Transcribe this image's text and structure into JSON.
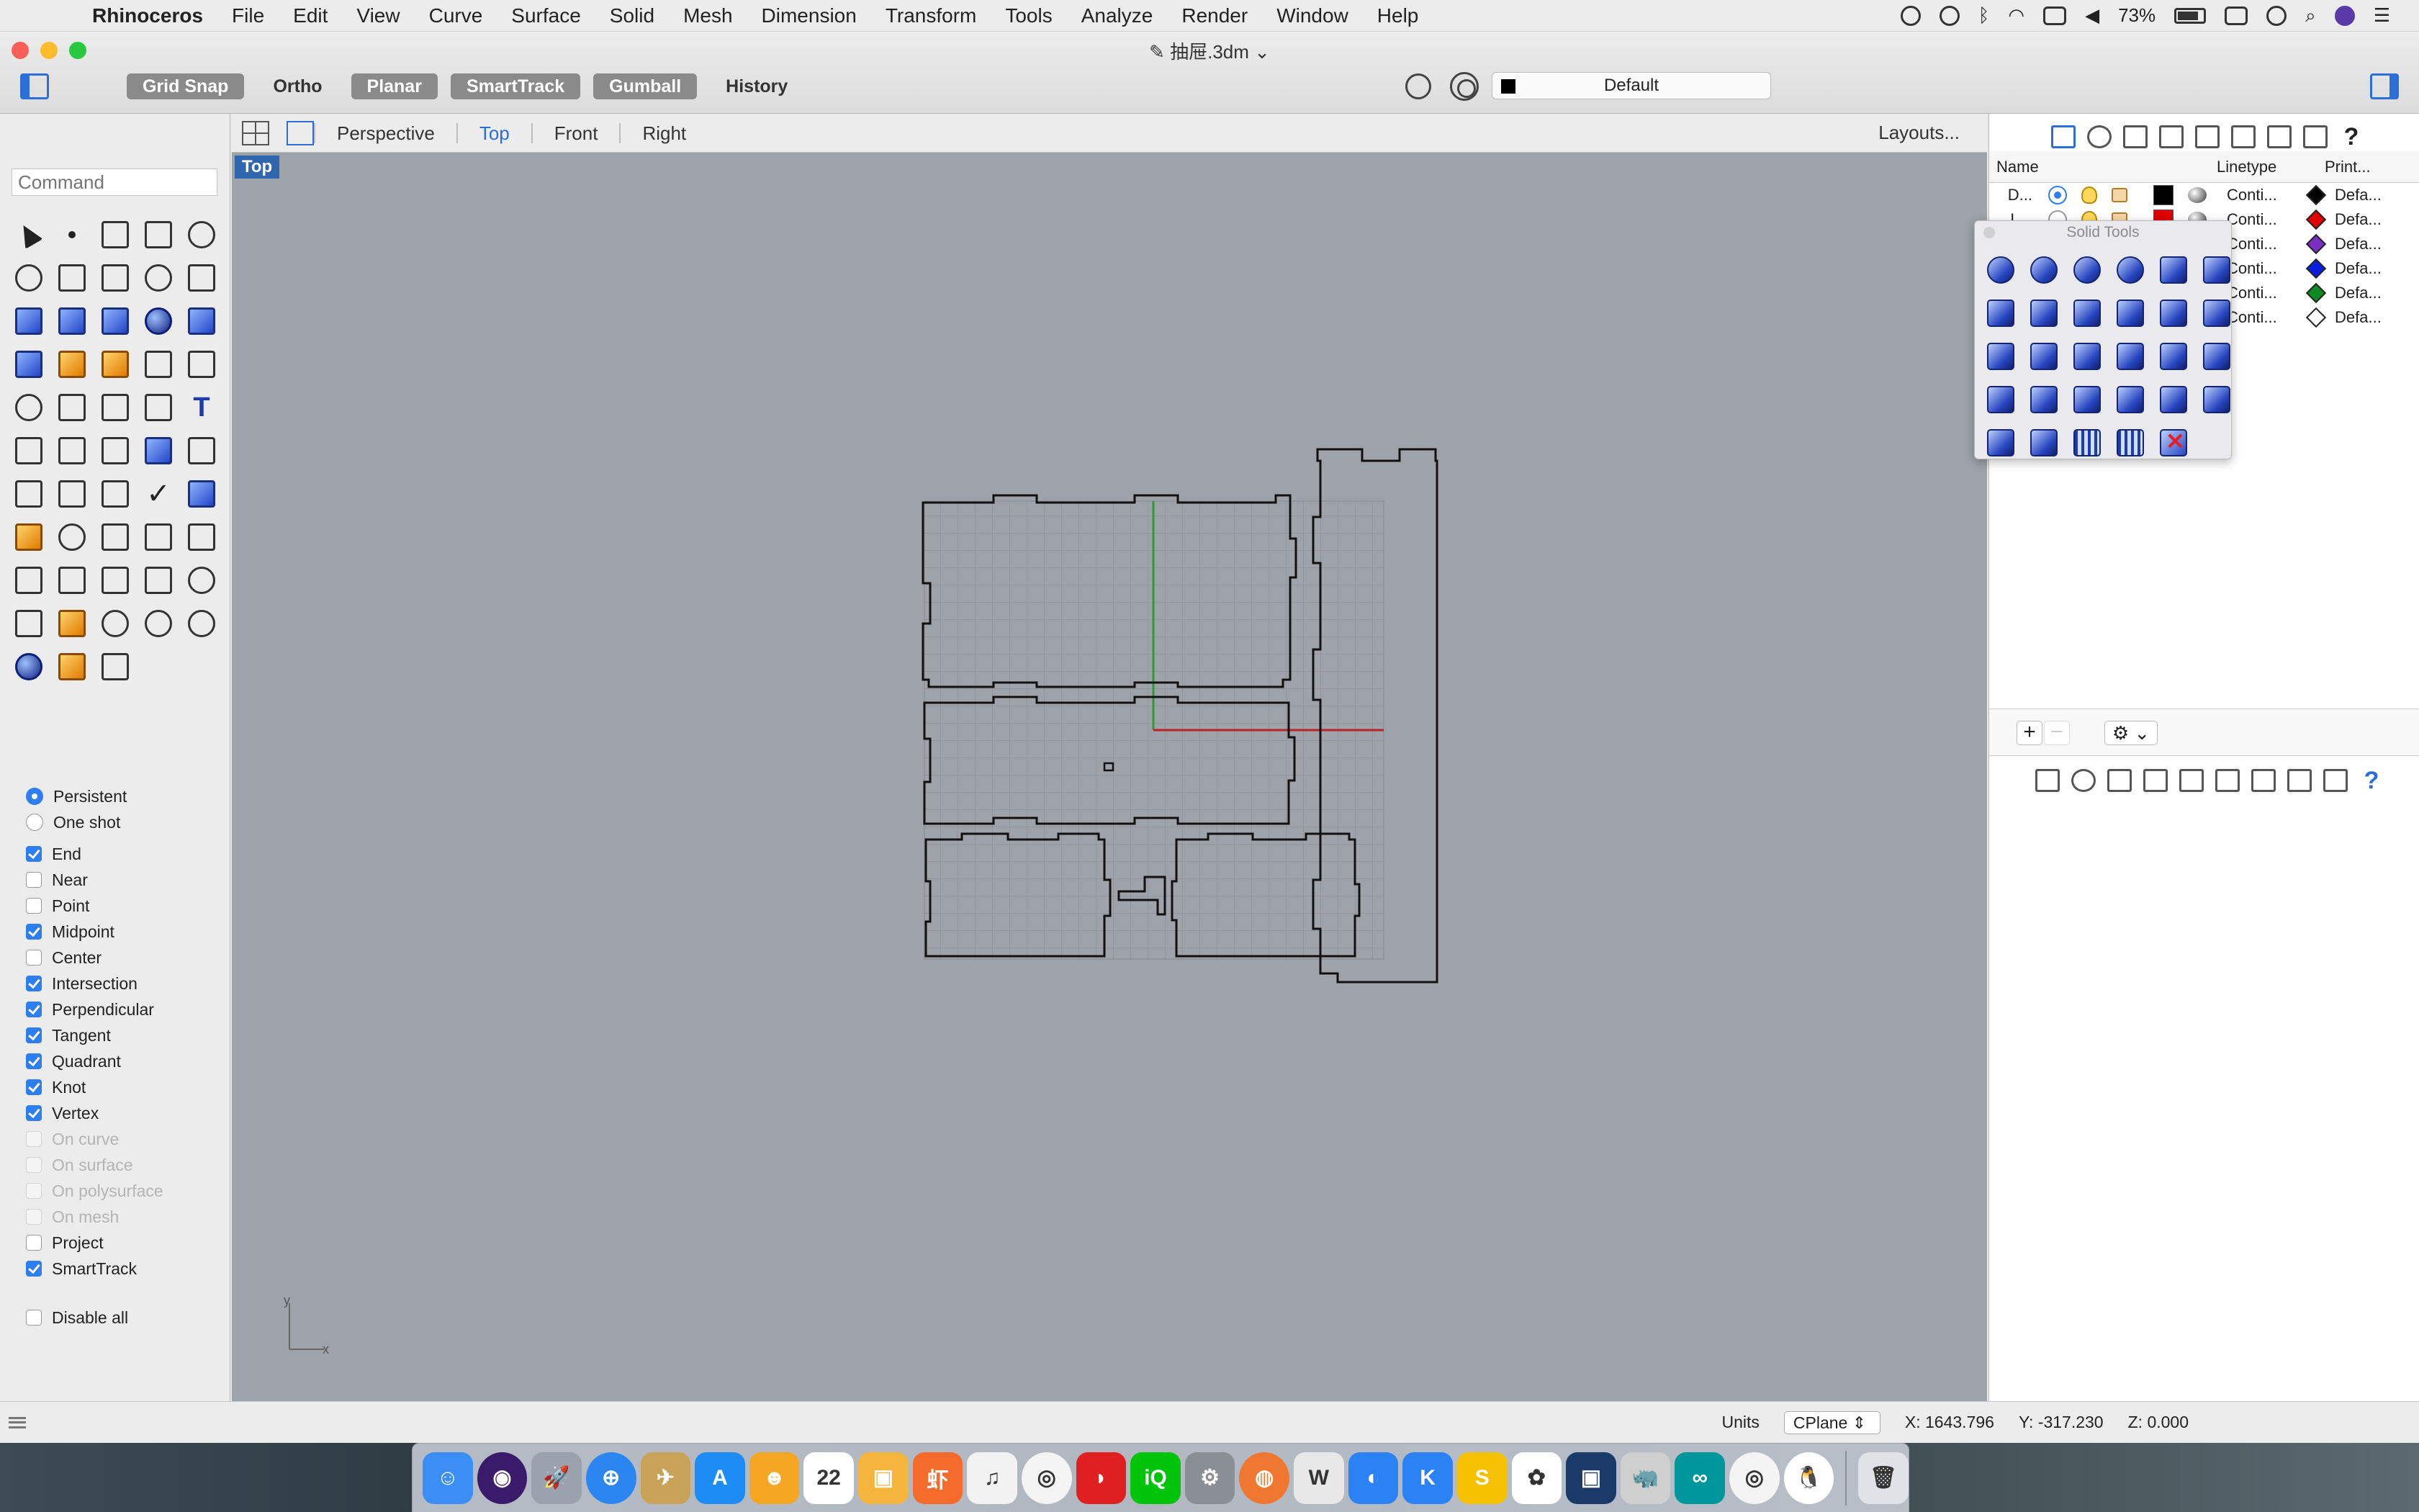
{
  "menubar": {
    "app_name": "Rhinoceros",
    "items": [
      "File",
      "Edit",
      "View",
      "Curve",
      "Surface",
      "Solid",
      "Mesh",
      "Dimension",
      "Transform",
      "Tools",
      "Analyze",
      "Render",
      "Window",
      "Help"
    ],
    "battery": "73%"
  },
  "window": {
    "title": "抽屉.3dm",
    "toggles": [
      "Grid Snap",
      "Ortho",
      "Planar",
      "SmartTrack",
      "Gumball",
      "History"
    ],
    "toggles_on": [
      true,
      false,
      true,
      true,
      true,
      false
    ],
    "current_layer": "Default"
  },
  "command": {
    "placeholder": "Command"
  },
  "tools": [
    "select-arrow",
    "point",
    "polyline",
    "curve",
    "circle",
    "ellipse",
    "polygon",
    "rectangle",
    "polygon-2",
    "fillet",
    "surface-patch",
    "extrude-surface",
    "box",
    "boolean-union",
    "cylinder",
    "plane-surface",
    "gear",
    "explode",
    "trim",
    "split",
    "boolean-difference",
    "group",
    "curve-edit",
    "offset",
    "text",
    "move",
    "array",
    "mirror",
    "box-edge",
    "dimension",
    "grid-array",
    "align",
    "blend",
    "check",
    "shade",
    "paint",
    "zoom",
    "zoom-window",
    "zoom-extents",
    "zoom-selected",
    "rotate-view",
    "car",
    "grid-surface",
    "lights",
    "bulb",
    "lock",
    "layer",
    "color-wheel",
    "sphere-wire",
    "sphere-grid",
    "render-sphere",
    "cone",
    "measure"
  ],
  "osnaps": {
    "mode": [
      {
        "label": "Persistent",
        "on": true
      },
      {
        "label": "One shot",
        "on": false
      }
    ],
    "items": [
      {
        "label": "End",
        "checked": true,
        "enabled": true
      },
      {
        "label": "Near",
        "checked": false,
        "enabled": true
      },
      {
        "label": "Point",
        "checked": false,
        "enabled": true
      },
      {
        "label": "Midpoint",
        "checked": true,
        "enabled": true
      },
      {
        "label": "Center",
        "checked": false,
        "enabled": true
      },
      {
        "label": "Intersection",
        "checked": true,
        "enabled": true
      },
      {
        "label": "Perpendicular",
        "checked": true,
        "enabled": true
      },
      {
        "label": "Tangent",
        "checked": true,
        "enabled": true
      },
      {
        "label": "Quadrant",
        "checked": true,
        "enabled": true
      },
      {
        "label": "Knot",
        "checked": true,
        "enabled": true
      },
      {
        "label": "Vertex",
        "checked": true,
        "enabled": true
      },
      {
        "label": "On curve",
        "checked": false,
        "enabled": false
      },
      {
        "label": "On surface",
        "checked": false,
        "enabled": false
      },
      {
        "label": "On polysurface",
        "checked": false,
        "enabled": false
      },
      {
        "label": "On mesh",
        "checked": false,
        "enabled": false
      },
      {
        "label": "Project",
        "checked": false,
        "enabled": true
      },
      {
        "label": "SmartTrack",
        "checked": true,
        "enabled": true
      }
    ],
    "disable_all": "Disable all"
  },
  "viewtabs": {
    "tabs": [
      "Perspective",
      "Top",
      "Front",
      "Right"
    ],
    "active": "Top",
    "layouts": "Layouts..."
  },
  "viewport": {
    "label": "Top",
    "axis_y": "y",
    "axis_x": "x"
  },
  "statusbar": {
    "units": "Units",
    "cplane": "CPlane",
    "x": "X: 1643.796",
    "y": "Y: -317.230",
    "z": "Z: 0.000"
  },
  "layers": {
    "headers": {
      "name": "Name",
      "linetype": "Linetype",
      "print": "Print..."
    },
    "rows": [
      {
        "name": "D...",
        "current": true,
        "color": "#000000",
        "linetype": "Conti...",
        "print_color": "#000000",
        "print": "Defa..."
      },
      {
        "name": "L...",
        "current": false,
        "color": "#e00000",
        "linetype": "Conti...",
        "print_color": "#e00000",
        "print": "Defa..."
      },
      {
        "name": "",
        "current": false,
        "color": "#7a2ec2",
        "linetype": "Conti...",
        "print_color": "#7a2ec2",
        "print": "Defa..."
      },
      {
        "name": "",
        "current": false,
        "color": "#0a1ee0",
        "linetype": "Conti...",
        "print_color": "#0a1ee0",
        "print": "Defa..."
      },
      {
        "name": "",
        "current": false,
        "color": "#0f8a20",
        "linetype": "Conti...",
        "print_color": "#0f8a20",
        "print": "Defa..."
      },
      {
        "name": "",
        "current": false,
        "color": "#ffffff",
        "linetype": "Conti...",
        "print_color": "#ffffff",
        "print": "Defa..."
      }
    ],
    "add": "+",
    "remove": "−",
    "gear": "⚙ ⌄"
  },
  "solid_tools": {
    "title": "Solid Tools",
    "buttons": [
      "boolean-union",
      "boolean-difference",
      "boolean-intersection",
      "boolean-split",
      "cap-planar-holes",
      "extract-surface",
      "extrude-face",
      "slab",
      "box-edge",
      "merge-faces",
      "fillet-edge",
      "chamfer-edge",
      "offset-face",
      "move-face",
      "move-edge",
      "split-face",
      "move-face-to",
      "extrude-curve",
      "wire-cut",
      "rib",
      "shell",
      "tapered-extrude",
      "unroll",
      "solid-point",
      "solid-edit-1",
      "solid-edit-2",
      "grid-points-1",
      "grid-points-2",
      "delete-hole"
    ]
  },
  "dock": {
    "apps": [
      {
        "name": "finder",
        "bg": "#3a8ef5",
        "glyph": "☺"
      },
      {
        "name": "siri",
        "bg": "#3a1a6a",
        "glyph": "◉"
      },
      {
        "name": "launchpad",
        "bg": "#9aa2ad",
        "glyph": "🚀"
      },
      {
        "name": "safari",
        "bg": "#2b86f2",
        "glyph": "⊕"
      },
      {
        "name": "preview",
        "bg": "#c9a25a",
        "glyph": "✈"
      },
      {
        "name": "app-store",
        "bg": "#1d8cf5",
        "glyph": "A"
      },
      {
        "name": "pages",
        "bg": "#f5a623",
        "glyph": "☻"
      },
      {
        "name": "calendar",
        "bg": "#ffffff",
        "glyph": "22"
      },
      {
        "name": "package",
        "bg": "#f5b43c",
        "glyph": "▣"
      },
      {
        "name": "xiami",
        "bg": "#f56b2b",
        "glyph": "虾"
      },
      {
        "name": "itunes",
        "bg": "#f2f2f2",
        "glyph": "♫"
      },
      {
        "name": "chrome",
        "bg": "#f4f4f4",
        "glyph": "◎"
      },
      {
        "name": "netease-music",
        "bg": "#e02020",
        "glyph": "◗"
      },
      {
        "name": "iqiyi",
        "bg": "#00c40a",
        "glyph": "iQ"
      },
      {
        "name": "system-preferences",
        "bg": "#8a8f96",
        "glyph": "⚙"
      },
      {
        "name": "firefox",
        "bg": "#f0772f",
        "glyph": "◍"
      },
      {
        "name": "wikipedia",
        "bg": "#e8e8e8",
        "glyph": "W"
      },
      {
        "name": "proxyman",
        "bg": "#2a82f5",
        "glyph": "◐"
      },
      {
        "name": "keynote",
        "bg": "#2a82f5",
        "glyph": "K"
      },
      {
        "name": "grasshopper-alt",
        "bg": "#f5c000",
        "glyph": "S"
      },
      {
        "name": "photos",
        "bg": "#ffffff",
        "glyph": "✿"
      },
      {
        "name": "studio",
        "bg": "#1a3a6a",
        "glyph": "▣"
      },
      {
        "name": "rhino",
        "bg": "#cfcfcf",
        "glyph": "🦏"
      },
      {
        "name": "arduino",
        "bg": "#00979c",
        "glyph": "∞"
      },
      {
        "name": "chrome-2",
        "bg": "#f4f4f4",
        "glyph": "◎"
      },
      {
        "name": "qq",
        "bg": "#ffffff",
        "glyph": "🐧"
      },
      {
        "name": "trash",
        "bg": "#dfe3e8",
        "glyph": "🗑"
      }
    ]
  }
}
